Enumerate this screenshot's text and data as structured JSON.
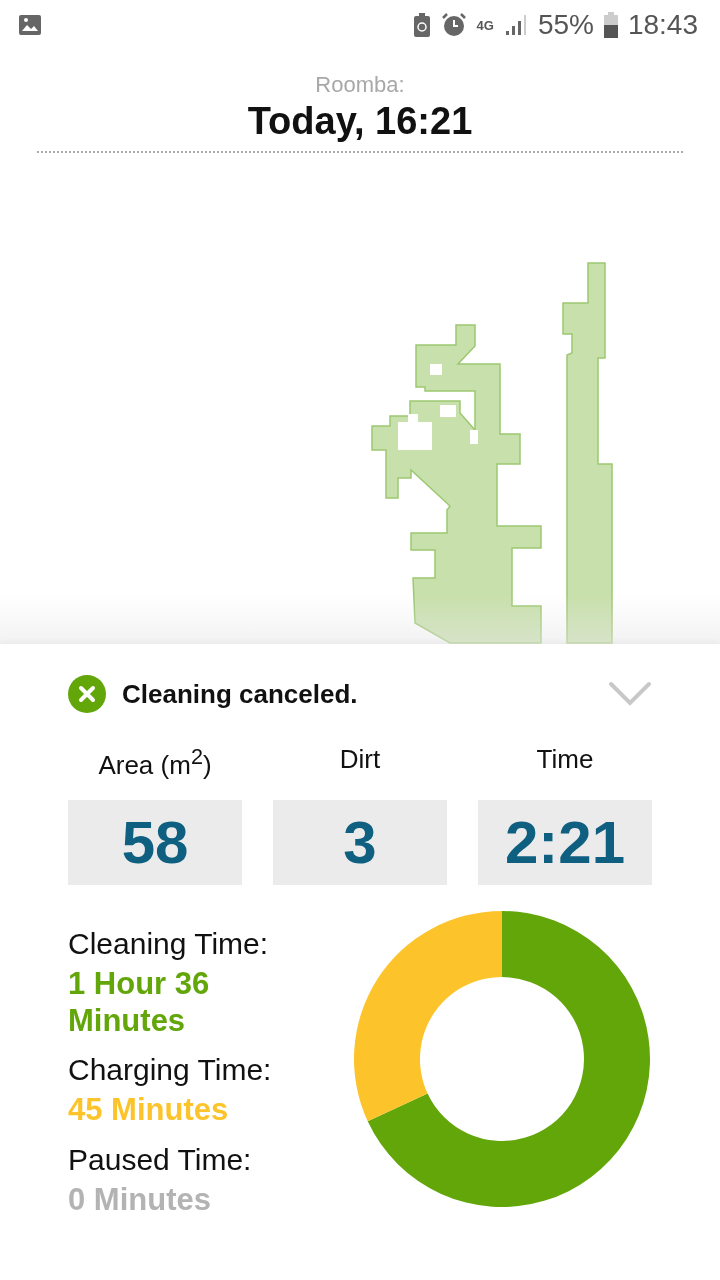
{
  "status_bar": {
    "network": "4G",
    "battery": "55%",
    "time": "18:43"
  },
  "header": {
    "subtitle": "Roomba:",
    "title": "Today, 16:21"
  },
  "summary": {
    "status": "Cleaning canceled."
  },
  "metrics": [
    {
      "label": "Area (m$^{2}$)",
      "value": "58"
    },
    {
      "label": "Dirt",
      "value": "3"
    },
    {
      "label": "Time",
      "value": "2:21"
    }
  ],
  "times": [
    {
      "label": "Cleaning Time:",
      "value": "1 Hour 36 Minutes",
      "color": "#62a60a"
    },
    {
      "label": "Charging Time:",
      "value": "45 Minutes",
      "color": "#fcc42a"
    },
    {
      "label": "Paused Time:",
      "value": "0 Minutes",
      "color": "#b3b3b3"
    }
  ],
  "chart_data": {
    "type": "donut",
    "values": [
      68.1,
      31.9,
      0
    ]
  }
}
